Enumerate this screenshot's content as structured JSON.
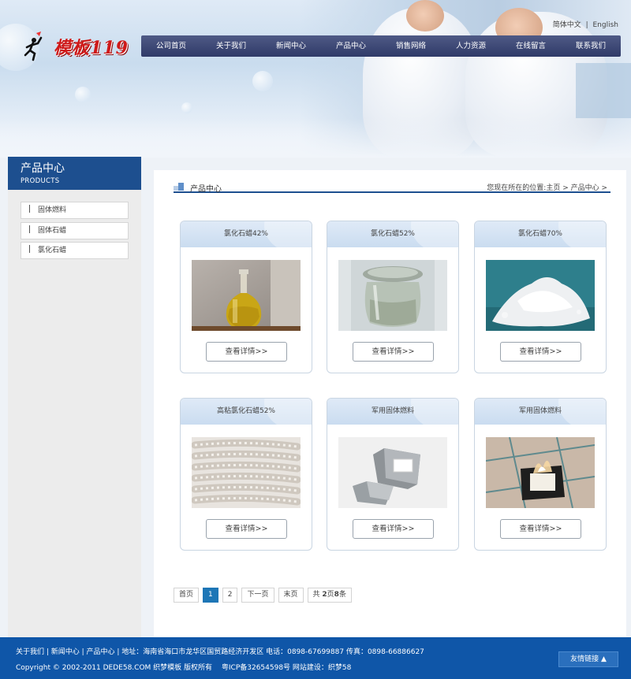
{
  "header": {
    "logo_text": "模板119",
    "lang": {
      "cn": "简体中文",
      "sep": "|",
      "en": "English"
    },
    "nav": [
      "公司首页",
      "关于我们",
      "新闻中心",
      "产品中心",
      "销售网络",
      "人力资源",
      "在线留言",
      "联系我们"
    ]
  },
  "sidebar": {
    "title": "产品中心",
    "subtitle": "PRODUCTS",
    "items": [
      "固体燃料",
      "固体石蜡",
      "氯化石蜡"
    ]
  },
  "main": {
    "section_title": "产品中心",
    "breadcrumb": "您现在所在的位置:主页 > 产品中心 >",
    "products": [
      {
        "name": "氯化石蜡42%",
        "image": "flask-yellow-liquid",
        "button": "查看详情>>"
      },
      {
        "name": "氯化石蜡52%",
        "image": "clear-liquid-jar",
        "button": "查看详情>>"
      },
      {
        "name": "氯化石蜡70%",
        "image": "white-powder",
        "button": "查看详情>>"
      },
      {
        "name": "高粘氯化石蜡52%",
        "image": "wax-strands",
        "button": "查看详情>>"
      },
      {
        "name": "军用固体燃料",
        "image": "fuel-stand",
        "button": "查看详情>>"
      },
      {
        "name": "军用固体燃料",
        "image": "burning-fuel",
        "button": "查看详情>>"
      }
    ],
    "pagination": {
      "first": "首页",
      "current": "1",
      "page2": "2",
      "next": "下一页",
      "last": "末页",
      "info_prefix": "共 ",
      "info_pages": "2",
      "info_mid": "页",
      "info_count": "8",
      "info_suffix": "条"
    }
  },
  "footer": {
    "links": "关于我们 | 新闻中心 | 产品中心 | 地址：海南省海口市龙华区国贸路经济开发区 电话：0898-67699887 传真：0898-66886627",
    "copyright": "Copyright © 2002-2011 DEDE58.COM 织梦模板 版权所有 　粤ICP备32654598号 网站建设：织梦58",
    "friend_links": "友情链接 ▲"
  },
  "colors": {
    "nav": "#2f3a68",
    "sidebar_head": "#1d4f8f",
    "footer": "#0f56a8",
    "page_active": "#1d76b6",
    "logo": "#cf1a1a"
  }
}
